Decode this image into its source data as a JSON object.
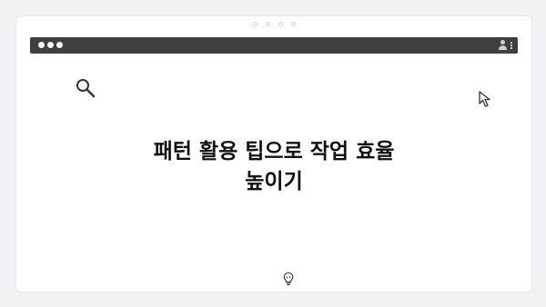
{
  "pager": {
    "dot_count": 4
  },
  "browser": {
    "window_controls": [
      "dot",
      "dot",
      "dot"
    ],
    "icons": [
      "user-icon",
      "kebab-menu-icon"
    ]
  },
  "content": {
    "title": "패턴 활용 팁으로 작업 효율\n높이기",
    "icons": [
      "search-icon",
      "cursor-arrow-icon",
      "lightbulb-icon"
    ]
  },
  "colors": {
    "background": "#f1f2f4",
    "browser_bar": "#3f3f3f",
    "card": "#ffffff",
    "title_text": "#111111"
  }
}
